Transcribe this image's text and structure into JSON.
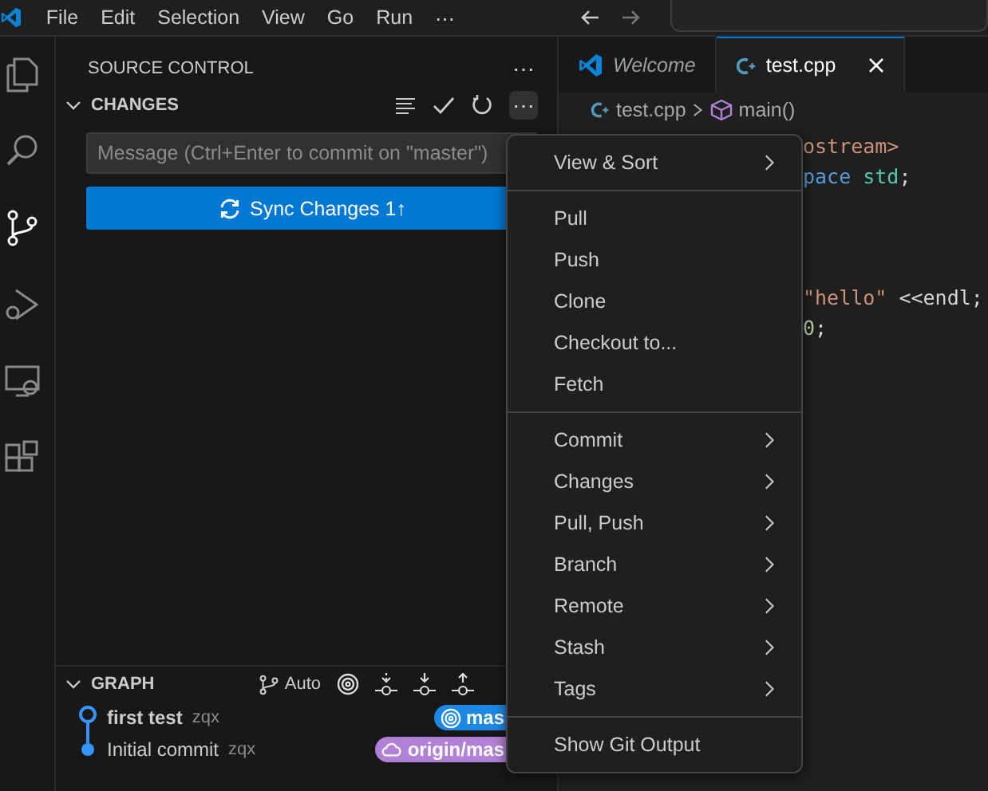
{
  "menubar": {
    "items": [
      "File",
      "Edit",
      "Selection",
      "View",
      "Go",
      "Run",
      "⋯"
    ]
  },
  "activity_bar": {
    "items": [
      {
        "kind": "files",
        "selected": false
      },
      {
        "kind": "search",
        "selected": false
      },
      {
        "kind": "source-control",
        "selected": true
      },
      {
        "kind": "debug",
        "selected": false
      },
      {
        "kind": "remote",
        "selected": false
      },
      {
        "kind": "extensions",
        "selected": false
      }
    ]
  },
  "sidebar": {
    "title": "SOURCE CONTROL",
    "more": "⋯",
    "changes": {
      "title": "CHANGES",
      "expanded": true,
      "more": "⋯",
      "message_placeholder": "Message (Ctrl+Enter to commit on \"master\")",
      "sync_button": "Sync Changes 1↑"
    },
    "graph": {
      "title": "GRAPH",
      "expanded": true,
      "auto": "Auto",
      "commits": [
        {
          "message": "first test",
          "author": "zqx",
          "head": true,
          "ref": {
            "label": "mas",
            "kind": "local"
          }
        },
        {
          "message": "Initial commit",
          "author": "zqx",
          "head": false,
          "ref": {
            "label": "origin/mas",
            "kind": "remote"
          }
        }
      ]
    }
  },
  "editor": {
    "tabs": [
      {
        "label": "Welcome",
        "kind": "welcome",
        "selected": false
      },
      {
        "label": "test.cpp",
        "kind": "file",
        "selected": true
      }
    ],
    "breadcrumbs": [
      "test.cpp",
      "main()"
    ],
    "code_blocks": [
      [
        [
          {
            "text": "ostream>",
            "kind": "string"
          }
        ],
        [
          {
            "text": "pace",
            "kind": "keyword"
          },
          {
            "text": " std",
            "kind": "type"
          },
          {
            "text": ";",
            "kind": "plain"
          }
        ]
      ],
      [
        [
          {
            "text": "\"hello\"",
            "kind": "string"
          },
          {
            "text": " <<endl;",
            "kind": "plain"
          }
        ],
        [
          {
            "text": "0",
            "kind": "number"
          },
          {
            "text": ";",
            "kind": "plain"
          }
        ]
      ]
    ]
  },
  "context_menu": {
    "groups": [
      [
        {
          "label": "View & Sort",
          "submenu": true
        }
      ],
      [
        {
          "label": "Pull",
          "submenu": false
        },
        {
          "label": "Push",
          "submenu": false
        },
        {
          "label": "Clone",
          "submenu": false
        },
        {
          "label": "Checkout to...",
          "submenu": false
        },
        {
          "label": "Fetch",
          "submenu": false
        }
      ],
      [
        {
          "label": "Commit",
          "submenu": true
        },
        {
          "label": "Changes",
          "submenu": true
        },
        {
          "label": "Pull, Push",
          "submenu": true
        },
        {
          "label": "Branch",
          "submenu": true
        },
        {
          "label": "Remote",
          "submenu": true
        },
        {
          "label": "Stash",
          "submenu": true
        },
        {
          "label": "Tags",
          "submenu": true
        }
      ],
      [
        {
          "label": "Show Git Output",
          "submenu": false
        }
      ]
    ]
  }
}
